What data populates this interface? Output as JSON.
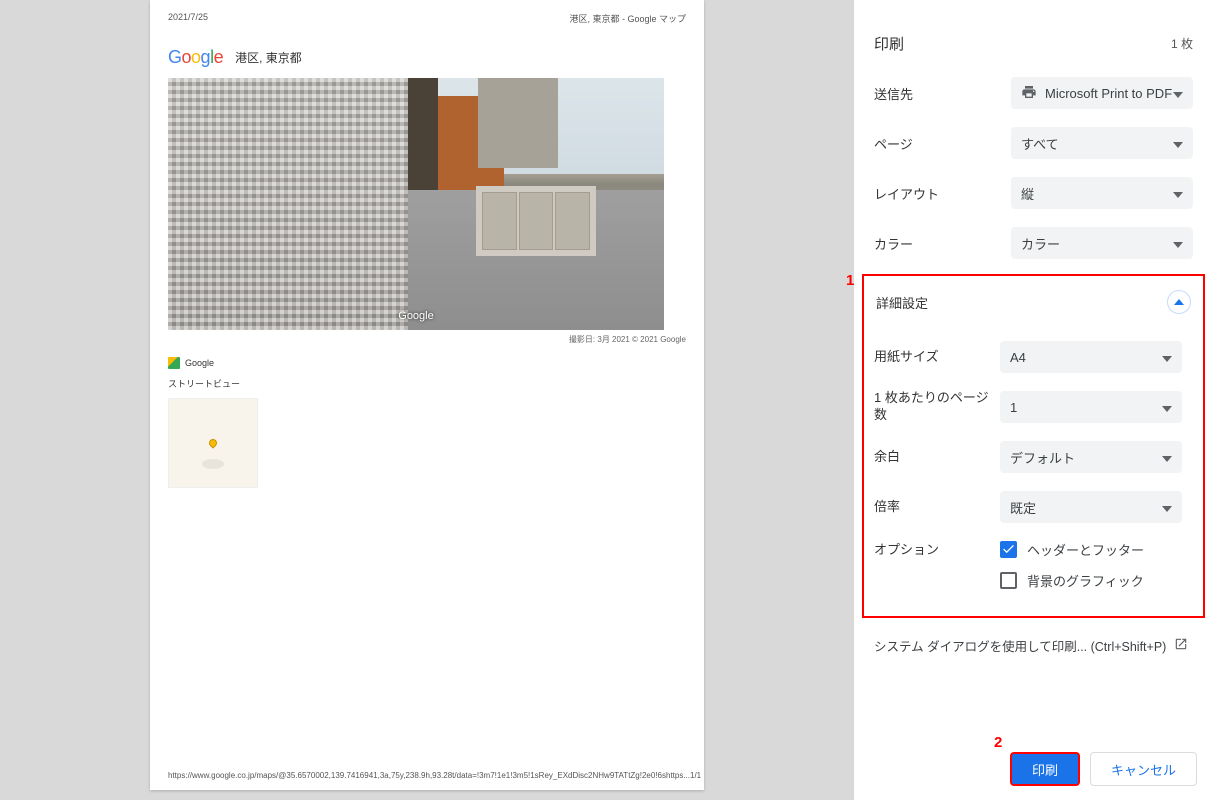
{
  "preview": {
    "date": "2021/7/25",
    "doc_title": "港区, 東京都 - Google マップ",
    "location_title": "港区, 東京都",
    "watermark": "Google",
    "photo_caption": "撮影日: 3月 2021    © 2021 Google",
    "provider": "Google",
    "subheading": "ストリートビュー",
    "footer_url": "https://www.google.co.jp/maps/@35.6570002,139.7416941,3a,75y,238.9h,93.28t/data=!3m7!1e1!3m5!1sRey_EXdDisc2NHw9TATtZg!2e0!6shttps...",
    "footer_page": "1/1"
  },
  "panel": {
    "title": "印刷",
    "page_count": "1 枚",
    "dest_label": "送信先",
    "dest_value": "Microsoft Print to PDF",
    "pages_label": "ページ",
    "pages_value": "すべて",
    "layout_label": "レイアウト",
    "layout_value": "縦",
    "color_label": "カラー",
    "color_value": "カラー",
    "advanced_label": "詳細設定",
    "paper_label": "用紙サイズ",
    "paper_value": "A4",
    "pps_label": "1 枚あたりのページ数",
    "pps_value": "1",
    "margin_label": "余白",
    "margin_value": "デフォルト",
    "scale_label": "倍率",
    "scale_value": "既定",
    "options_label": "オプション",
    "opt_header": "ヘッダーとフッター",
    "opt_bg": "背景のグラフィック",
    "sys_dialog": "システム ダイアログを使用して印刷... (Ctrl+Shift+P)",
    "btn_print": "印刷",
    "btn_cancel": "キャンセル"
  },
  "annotations": {
    "a1": "1",
    "a2": "2"
  }
}
